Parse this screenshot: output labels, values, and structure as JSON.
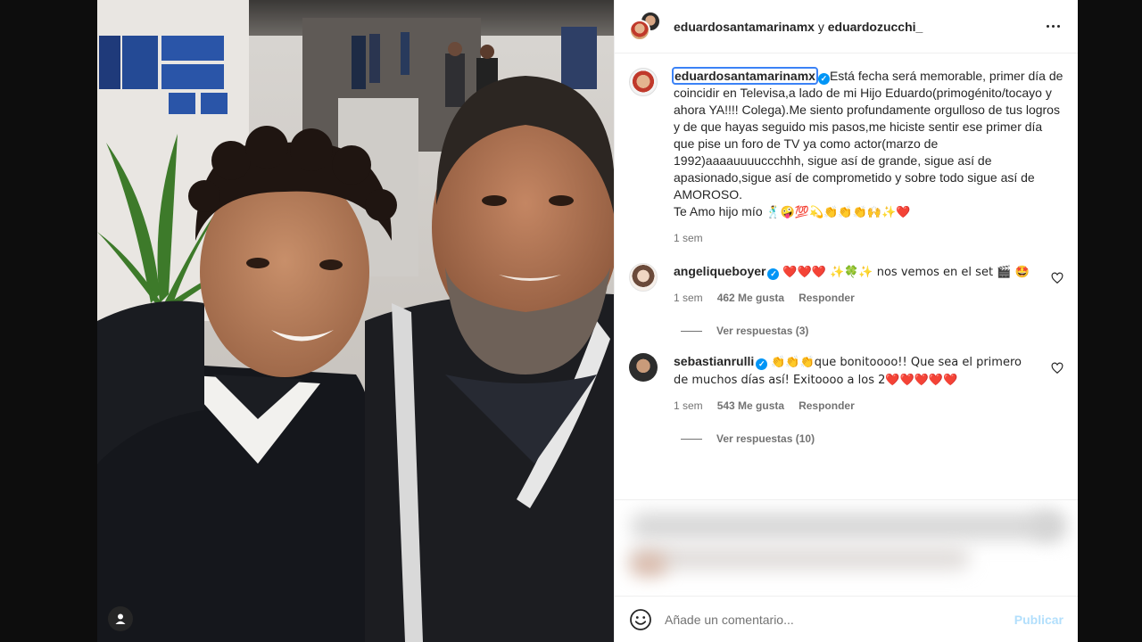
{
  "header": {
    "user1": "eduardosantamarinamx",
    "joiner": " y ",
    "user2": "eduardozucchi_"
  },
  "caption": {
    "username": "eduardosantamarinamx",
    "text": "Está fecha será memorable, primer día de coincidir en Televisa,a lado de mi Hijo Eduardo(primogénito/tocayo y ahora YA!!!! Colega).Me siento profundamente orgulloso de tus logros y de que hayas seguido mis pasos,me hiciste sentir ese primer día que pise un foro de TV ya como actor(marzo de 1992)aaaauuuuccchhh, sigue así de grande, sigue así de apasionado,sigue así de comprometido y sobre todo sigue así de AMOROSO.",
    "signoff": "Te Amo hijo mío",
    "signoff_emojis": "🕺🤪💯💫👏👏👏🙌✨❤️",
    "time": "1 sem"
  },
  "comments": [
    {
      "username": "angeliqueboyer",
      "text": "❤️❤️❤️ ✨🍀✨ nos vemos en el set 🎬 🤩",
      "time": "1 sem",
      "likes": "462 Me gusta",
      "reply": "Responder",
      "replies": "Ver respuestas (3)"
    },
    {
      "username": "sebastianrulli",
      "text": "👏👏👏que bonitoooo!! Que sea el primero de muchos días así! Exitoooo a los 2❤️❤️❤️❤️❤️",
      "time": "1 sem",
      "likes": "543 Me gusta",
      "reply": "Responder",
      "replies": "Ver respuestas (10)"
    }
  ],
  "composer": {
    "placeholder": "Añade un comentario...",
    "publish": "Publicar"
  },
  "icons": {
    "verified": "verified-badge-icon",
    "more": "more-options-icon",
    "heart": "heart-outline-icon",
    "emoji": "emoji-smile-icon",
    "user_tag": "user-tag-icon"
  },
  "colors": {
    "verified": "#0095f6",
    "publish_disabled": "#b2dffc",
    "heart_red": "#ed4956",
    "focus_outline": "#3b82f6"
  }
}
